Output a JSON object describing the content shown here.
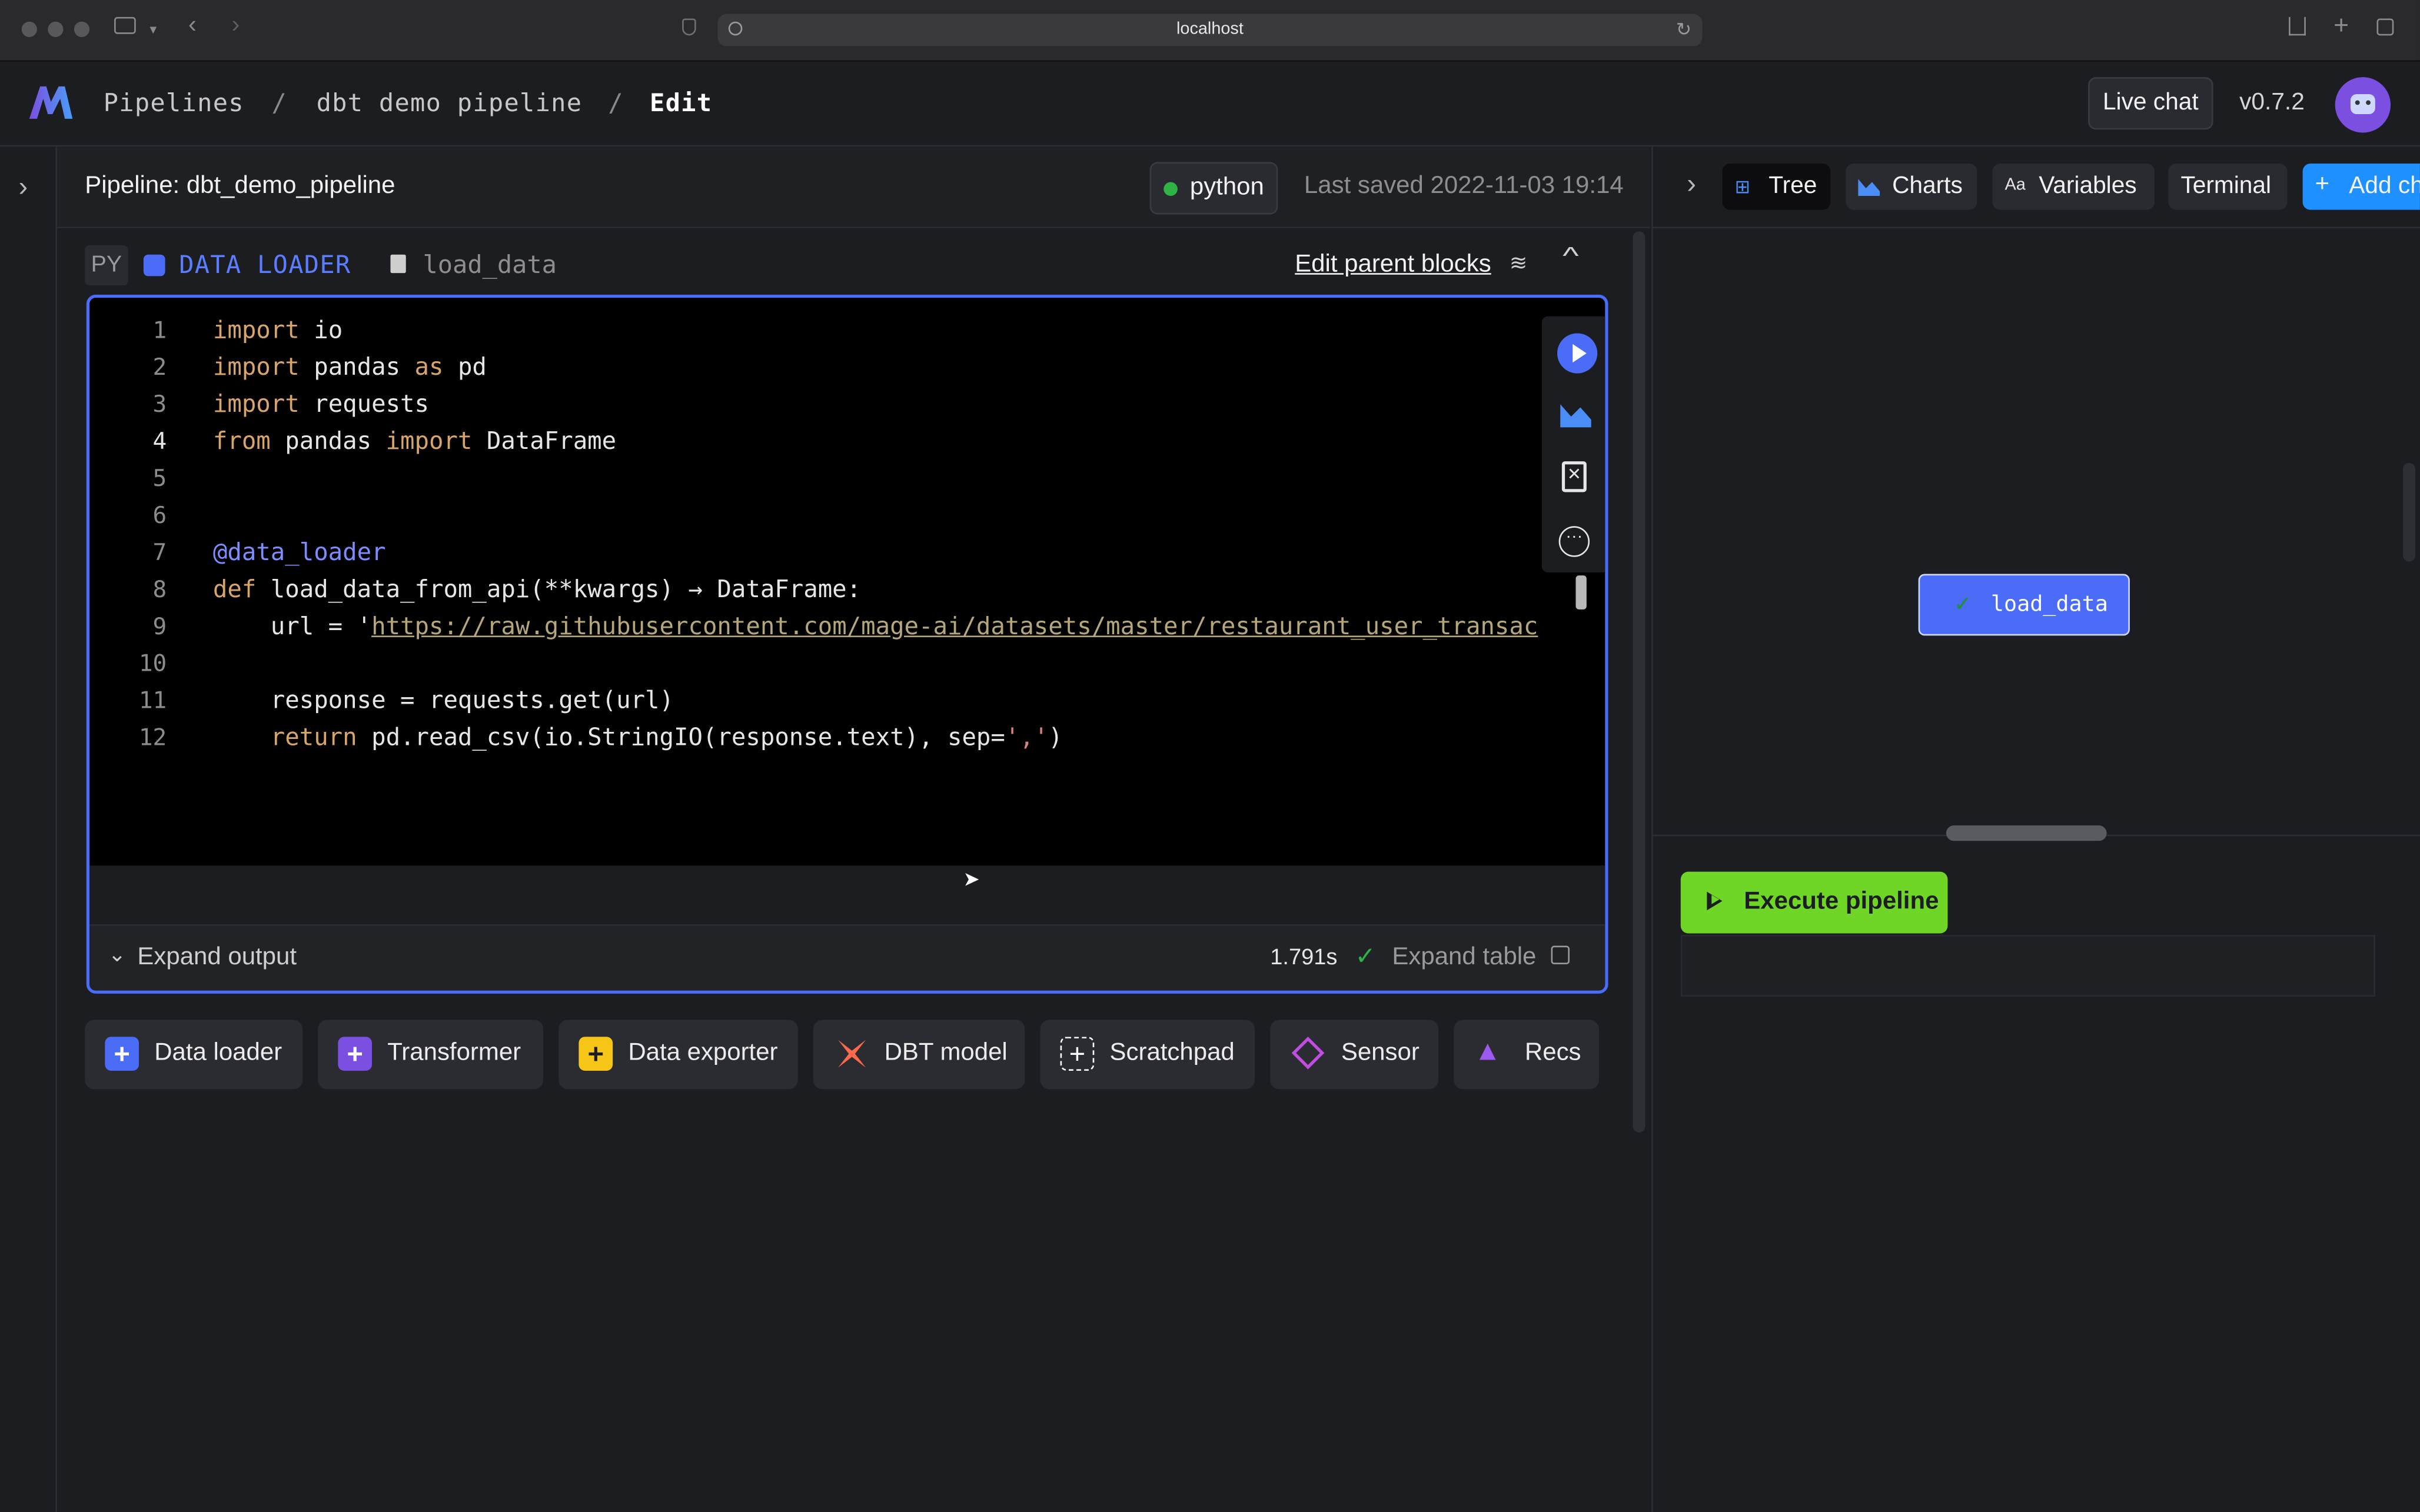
{
  "browser": {
    "url": "localhost"
  },
  "header": {
    "logo": "M",
    "breadcrumb": [
      "Pipelines",
      "/",
      "dbt demo pipeline",
      "/",
      "Edit"
    ],
    "live_chat": "Live chat",
    "version": "v0.7.2"
  },
  "pipeline_bar": {
    "title": "Pipeline: dbt_demo_pipeline",
    "kernel": "python",
    "kernel_status_color": "#2fb344",
    "last_saved": "Last saved 2022-11-03 19:14"
  },
  "block": {
    "language": "PY",
    "type_label": "DATA LOADER",
    "type_color": "#4a6cf7",
    "name": "load_data",
    "edit_parent": "Edit parent blocks",
    "code_lines": [
      {
        "n": "1",
        "text": "import io"
      },
      {
        "n": "2",
        "text": "import pandas as pd"
      },
      {
        "n": "3",
        "text": "import requests"
      },
      {
        "n": "4",
        "text": "from pandas import DataFrame"
      },
      {
        "n": "5",
        "text": ""
      },
      {
        "n": "6",
        "text": ""
      },
      {
        "n": "7",
        "text": "@data_loader"
      },
      {
        "n": "8",
        "text": "def load_data_from_api(**kwargs) → DataFrame:"
      },
      {
        "n": "9",
        "text": "    url = 'https://raw.githubusercontent.com/mage-ai/datasets/master/restaurant_user_transac"
      },
      {
        "n": "10",
        "text": ""
      },
      {
        "n": "11",
        "text": "    response = requests.get(url)"
      },
      {
        "n": "12",
        "text": "    return pd.read_csv(io.StringIO(response.text), sep=',')"
      }
    ],
    "expand_output": "Expand output",
    "runtime": "1.791s",
    "expand_table": "Expand table"
  },
  "add_blocks": [
    {
      "label": "Data loader",
      "icon": "plus-icon",
      "color": "#4a6cf7"
    },
    {
      "label": "Transformer",
      "icon": "plus-icon",
      "color": "#7b4fe0"
    },
    {
      "label": "Data exporter",
      "icon": "plus-icon",
      "color": "#f5c518"
    },
    {
      "label": "DBT model",
      "icon": "dbt-icon",
      "color": "#ff694b"
    },
    {
      "label": "Scratchpad",
      "icon": "plus-outline-icon",
      "color": "#ffffff"
    },
    {
      "label": "Sensor",
      "icon": "sensor-icon",
      "color": "#c04ee0"
    },
    {
      "label": "Recs",
      "icon": "wizard-icon",
      "color": "#9b59f0"
    }
  ],
  "right_panel": {
    "tabs": [
      "Tree",
      "Charts",
      "Variables",
      "Terminal"
    ],
    "add_chart": "Add ch",
    "tree_node": "load_data",
    "execute": "Execute pipeline"
  }
}
